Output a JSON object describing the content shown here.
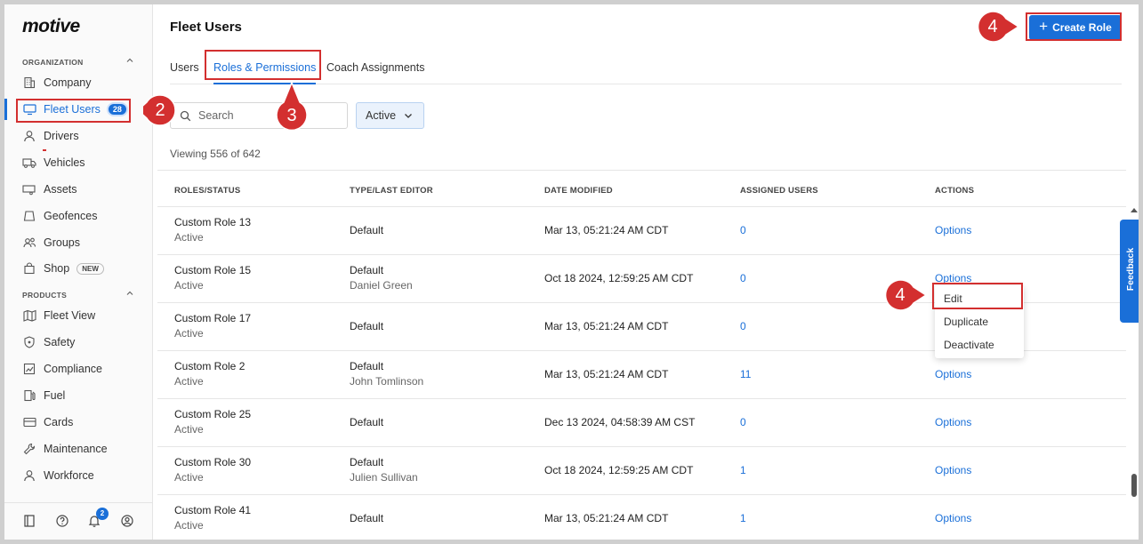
{
  "app": {
    "logo": "motive",
    "page_title": "Fleet Users"
  },
  "sidebar": {
    "organization_label": "ORGANIZATION",
    "products_label": "PRODUCTS",
    "org_items": [
      {
        "label": "Company",
        "icon": "building-icon"
      },
      {
        "label": "Fleet Users",
        "icon": "monitor-icon",
        "badge": "28",
        "active": true
      },
      {
        "label": "Drivers",
        "icon": "person-icon"
      },
      {
        "label": "Vehicles",
        "icon": "truck-icon"
      },
      {
        "label": "Assets",
        "icon": "trailer-icon"
      },
      {
        "label": "Geofences",
        "icon": "geofence-icon"
      },
      {
        "label": "Groups",
        "icon": "groups-icon"
      },
      {
        "label": "Shop",
        "icon": "shop-icon",
        "pill": "NEW"
      }
    ],
    "product_items": [
      {
        "label": "Fleet View",
        "icon": "map-icon"
      },
      {
        "label": "Safety",
        "icon": "shield-icon"
      },
      {
        "label": "Compliance",
        "icon": "compliance-icon"
      },
      {
        "label": "Fuel",
        "icon": "fuel-icon"
      },
      {
        "label": "Cards",
        "icon": "card-icon"
      },
      {
        "label": "Maintenance",
        "icon": "wrench-icon"
      },
      {
        "label": "Workforce",
        "icon": "workforce-icon"
      }
    ],
    "bottom": {
      "notification_count": "2"
    }
  },
  "header": {
    "create_button": "Create Role"
  },
  "tabs": [
    {
      "label": "Users"
    },
    {
      "label": "Roles & Permissions",
      "active": true
    },
    {
      "label": "Coach Assignments"
    }
  ],
  "filters": {
    "search_placeholder": "Search",
    "status_value": "Active"
  },
  "viewing_text": "Viewing 556 of 642",
  "table": {
    "columns": [
      "ROLES/STATUS",
      "TYPE/LAST EDITOR",
      "DATE MODIFIED",
      "ASSIGNED USERS",
      "ACTIONS"
    ],
    "rows": [
      {
        "role": "Custom Role 13",
        "status": "Active",
        "type": "Default",
        "editor": "",
        "date": "Mar 13, 05:21:24 AM CDT",
        "assigned": "0",
        "action": "Options"
      },
      {
        "role": "Custom Role 15",
        "status": "Active",
        "type": "Default",
        "editor": "Daniel Green",
        "date": "Oct 18 2024, 12:59:25 AM CDT",
        "assigned": "0",
        "action": "Options"
      },
      {
        "role": "Custom Role 17",
        "status": "Active",
        "type": "Default",
        "editor": "",
        "date": "Mar 13, 05:21:24 AM CDT",
        "assigned": "0",
        "action": ""
      },
      {
        "role": "Custom Role 2",
        "status": "Active",
        "type": "Default",
        "editor": "John Tomlinson",
        "date": "Mar 13, 05:21:24 AM CDT",
        "assigned": "11",
        "action": "Options"
      },
      {
        "role": "Custom Role 25",
        "status": "Active",
        "type": "Default",
        "editor": "",
        "date": "Dec 13 2024, 04:58:39 AM CST",
        "assigned": "0",
        "action": "Options"
      },
      {
        "role": "Custom Role 30",
        "status": "Active",
        "type": "Default",
        "editor": "Julien Sullivan",
        "date": "Oct 18 2024, 12:59:25 AM CDT",
        "assigned": "1",
        "action": "Options"
      },
      {
        "role": "Custom Role 41",
        "status": "Active",
        "type": "Default",
        "editor": "",
        "date": "Mar 13, 05:21:24 AM CDT",
        "assigned": "1",
        "action": "Options"
      }
    ]
  },
  "options_menu": {
    "items": [
      "Edit",
      "Duplicate",
      "Deactivate"
    ]
  },
  "feedback_tab": "Feedback",
  "annotations": {
    "step_2": "2",
    "step_3": "3",
    "step_4_top": "4",
    "step_4_menu": "4"
  },
  "colors": {
    "accent": "#1a6fd8",
    "annotation": "#d32f2f"
  }
}
